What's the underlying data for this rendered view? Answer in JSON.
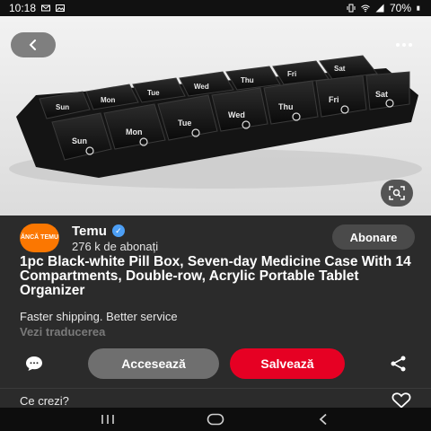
{
  "status_bar": {
    "time": "10:18",
    "battery": "70%",
    "icons": [
      "mail-icon",
      "image-icon",
      "vibrate-icon",
      "wifi-icon",
      "signal-icon",
      "battery-icon"
    ]
  },
  "hero": {
    "image_subject": "pill-box-photo",
    "pill_labels_top": [
      "Sun",
      "Mon",
      "Tue",
      "Wed",
      "Thu",
      "Fri",
      "Sat"
    ],
    "pill_labels_bottom": [
      "Sun",
      "Mon",
      "Tue",
      "Wed",
      "Thu",
      "Fri",
      "Sat"
    ]
  },
  "channel": {
    "avatar_text": "ĂNCĂ TEMU",
    "name": "Temu",
    "subscribers": "276 k de abonați",
    "subscribe_label": "Abonare"
  },
  "pin": {
    "title": "1pc Black-white Pill Box, Seven-day Medicine Case With 14 Compartments, Double-row, Acrylic Portable Tablet Organizer",
    "description": "Faster shipping. Better service",
    "translate_label": "Vezi traducerea"
  },
  "actions": {
    "access_label": "Accesează",
    "save_label": "Salvează"
  },
  "comments": {
    "prompt": "Ce crezi?"
  },
  "colors": {
    "save_button": "#e60023",
    "access_button": "#6f6f6f",
    "background": "#2b2b2b",
    "brand_orange": "#fb7701",
    "verified_blue": "#4d9ff5"
  }
}
